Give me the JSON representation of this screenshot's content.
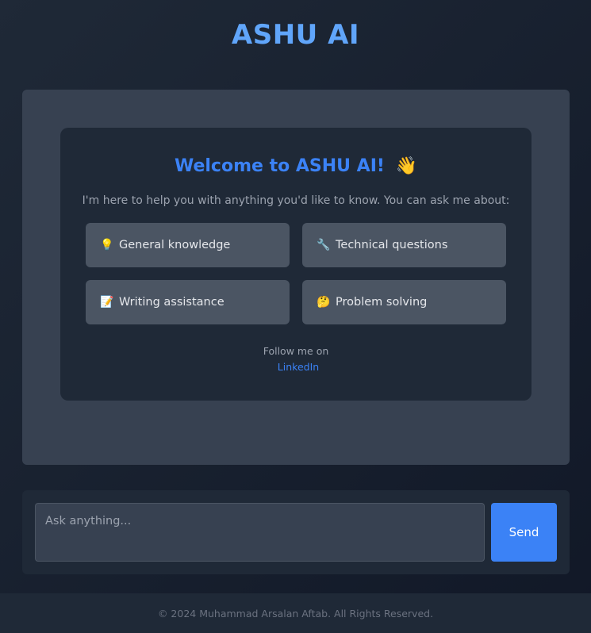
{
  "header": {
    "title": "ASHU AI"
  },
  "welcome": {
    "title": "Welcome to ASHU AI!",
    "wave_emoji": "👋",
    "description": "I'm here to help you with anything you'd like to know. You can ask me about:",
    "topics": [
      {
        "icon": "💡",
        "icon_name": "lightbulb-icon",
        "label": "General knowledge"
      },
      {
        "icon": "🔧",
        "icon_name": "wrench-icon",
        "label": "Technical questions"
      },
      {
        "icon": "📝",
        "icon_name": "memo-icon",
        "label": "Writing assistance"
      },
      {
        "icon": "🤔",
        "icon_name": "thinking-face-icon",
        "label": "Problem solving"
      }
    ],
    "follow_text": "Follow me on",
    "follow_link": "LinkedIn"
  },
  "input": {
    "placeholder": "Ask anything...",
    "send_label": "Send"
  },
  "footer": {
    "text": "© 2024 Muhammad Arsalan Aftab. All Rights Reserved."
  },
  "colors": {
    "accent": "#3b82f6",
    "title": "#60a5fa",
    "background": "#111827",
    "panel": "#374151",
    "card": "#1f2937",
    "topic": "#4b5563"
  }
}
